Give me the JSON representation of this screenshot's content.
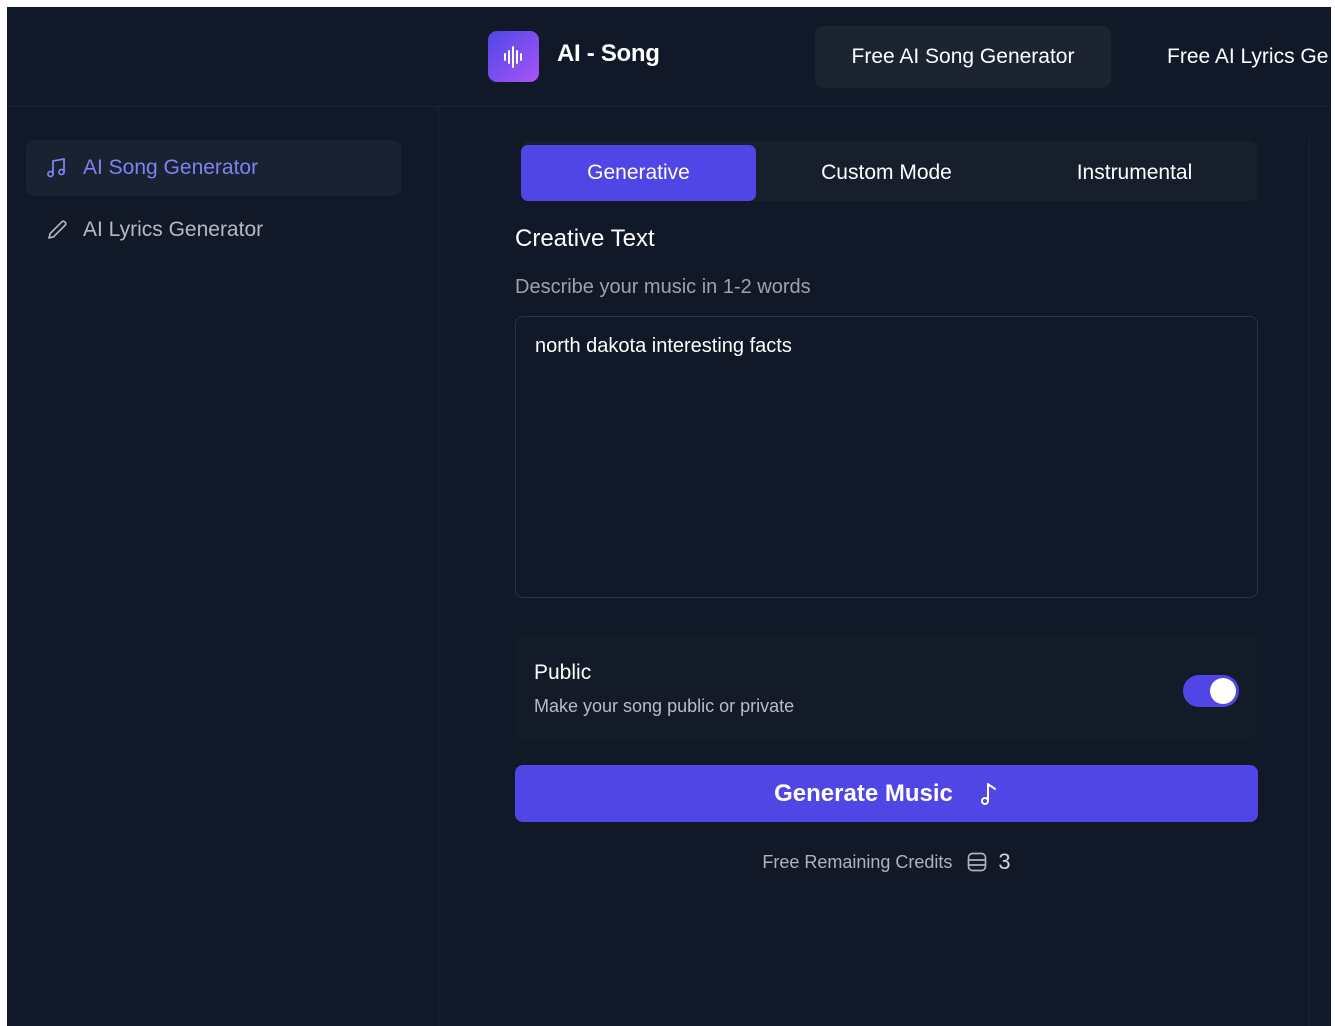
{
  "header": {
    "brand": "AI - Song",
    "nav_active": "Free AI Song Generator",
    "nav_next": "Free AI Lyrics Ge"
  },
  "sidebar": {
    "items": [
      {
        "label": "AI Song Generator",
        "icon": "music-note-icon",
        "active": true
      },
      {
        "label": "AI Lyrics Generator",
        "icon": "pencil-icon",
        "active": false
      }
    ]
  },
  "main": {
    "tabs": [
      {
        "label": "Generative",
        "active": true
      },
      {
        "label": "Custom Mode",
        "active": false
      },
      {
        "label": "Instrumental",
        "active": false
      }
    ],
    "creative_title": "Creative Text",
    "creative_subtitle": "Describe your music in 1-2 words",
    "prompt_value": "north dakota interesting facts",
    "public_title": "Public",
    "public_subtitle": "Make your song public or private",
    "public_enabled": true,
    "generate_label": "Generate Music",
    "credits_label": "Free Remaining Credits",
    "credits_count": "3"
  },
  "colors": {
    "background": "#111827",
    "accent": "#4f46e5",
    "active_sidebar_text": "#7c83f3"
  }
}
